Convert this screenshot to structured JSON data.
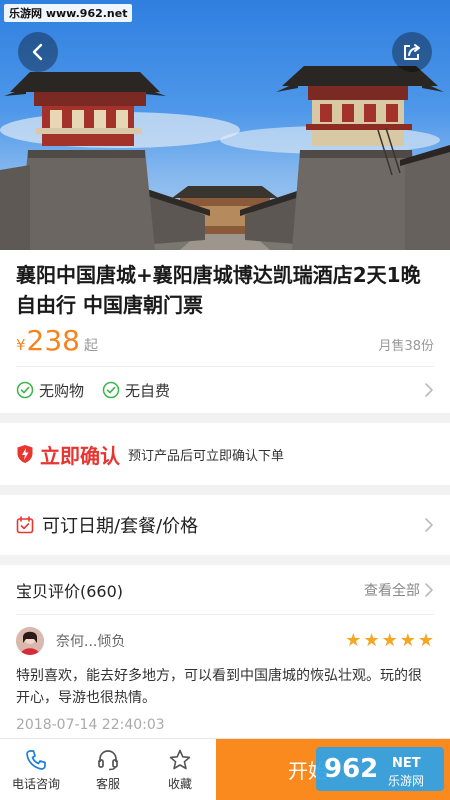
{
  "watermark": "乐游网 www.962.net",
  "product": {
    "title": "襄阳中国唐城+襄阳唐城博达凯瑞酒店2天1晚自由行 中国唐朝门票",
    "currency": "¥",
    "price": "238",
    "price_suffix": "起",
    "sold": "月售38份"
  },
  "tags": [
    "无购物",
    "无自费"
  ],
  "confirm": {
    "title": "立即确认",
    "desc": "预订产品后可立即确认下单"
  },
  "date_option": "可订日期/套餐/价格",
  "reviews": {
    "title": "宝贝评价(660)",
    "view_all": "查看全部",
    "user": "奈何...倾负",
    "rating": 5,
    "text": "特别喜欢，能去好多地方，可以看到中国唐城的恢弘壮观。玩的很开心，导游也很热情。",
    "time": "2018-07-14 22:40:03"
  },
  "bottom_nav": {
    "phone": "电话咨询",
    "service": "客服",
    "favorite": "收藏",
    "book_partial": "开始",
    "logo_text": "962",
    "logo_sub": "NET",
    "logo_brand": "乐游网"
  },
  "colors": {
    "accent_orange": "#f5841f",
    "book_button": "#fb8a1e",
    "confirm_red": "#e8352f",
    "tag_green": "#3bb54a",
    "star": "#f5a623"
  },
  "icons": [
    "back-arrow-icon",
    "share-icon",
    "check-circle-icon",
    "chevron-right-icon",
    "shield-bolt-icon",
    "calendar-icon",
    "phone-icon",
    "headset-icon",
    "star-outline-icon"
  ]
}
